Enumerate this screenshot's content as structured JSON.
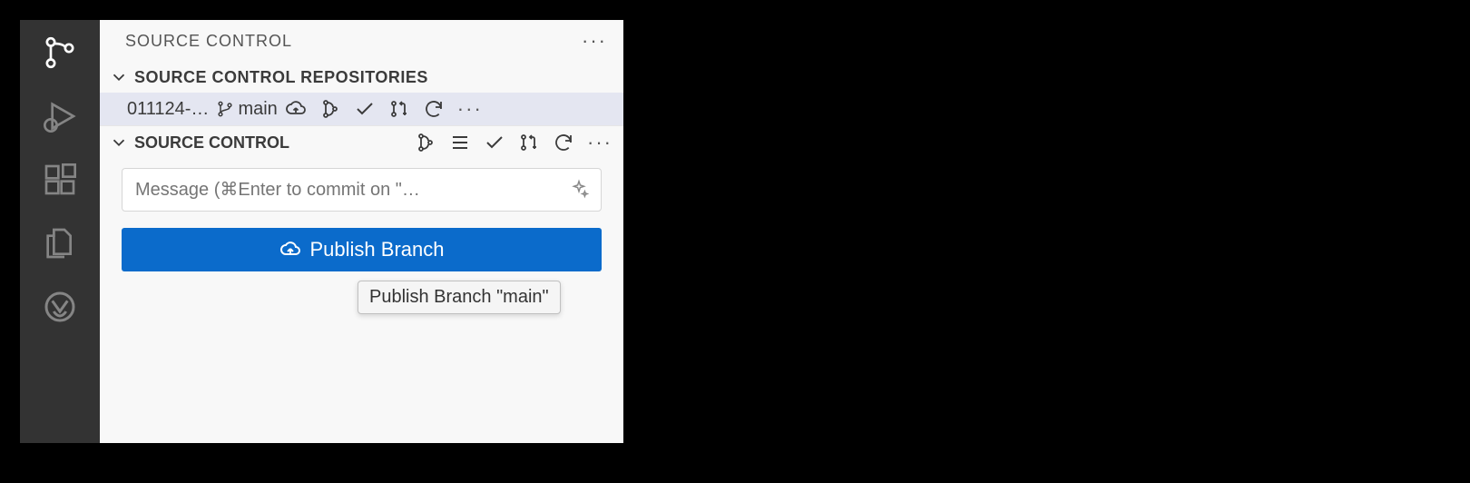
{
  "panel": {
    "title": "SOURCE CONTROL",
    "repositories_section": "SOURCE CONTROL REPOSITORIES",
    "source_control_section": "SOURCE CONTROL"
  },
  "repo": {
    "name": "011124-…",
    "branch": "main"
  },
  "commit": {
    "placeholder": "Message (⌘Enter to commit on \"…"
  },
  "button": {
    "publish": "Publish Branch"
  },
  "tooltip": {
    "publish": "Publish Branch \"main\""
  }
}
